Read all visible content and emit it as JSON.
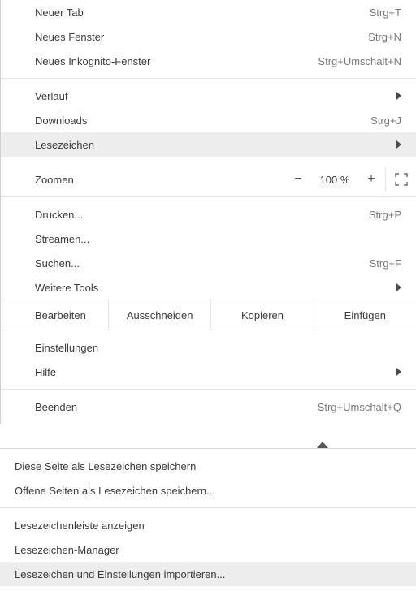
{
  "menu": {
    "new_tab": {
      "label": "Neuer Tab",
      "shortcut": "Strg+T"
    },
    "new_window": {
      "label": "Neues Fenster",
      "shortcut": "Strg+N"
    },
    "new_incognito": {
      "label": "Neues Inkognito-Fenster",
      "shortcut": "Strg+Umschalt+N"
    },
    "history": {
      "label": "Verlauf"
    },
    "downloads": {
      "label": "Downloads",
      "shortcut": "Strg+J"
    },
    "bookmarks": {
      "label": "Lesezeichen"
    },
    "zoom": {
      "label": "Zoomen",
      "value": "100 %"
    },
    "print": {
      "label": "Drucken...",
      "shortcut": "Strg+P"
    },
    "cast": {
      "label": "Streamen..."
    },
    "find": {
      "label": "Suchen...",
      "shortcut": "Strg+F"
    },
    "more_tools": {
      "label": "Weitere Tools"
    },
    "edit": {
      "label": "Bearbeiten",
      "cut": "Ausschneiden",
      "copy": "Kopieren",
      "paste": "Einfügen"
    },
    "settings": {
      "label": "Einstellungen"
    },
    "help": {
      "label": "Hilfe"
    },
    "exit": {
      "label": "Beenden",
      "shortcut": "Strg+Umschalt+Q"
    }
  },
  "bookmarks_submenu": {
    "bookmark_page": "Diese Seite als Lesezeichen speichern",
    "bookmark_open_pages": "Offene Seiten als Lesezeichen speichern...",
    "show_bar": "Lesezeichenleiste anzeigen",
    "manager": "Lesezeichen-Manager",
    "import": "Lesezeichen und Einstellungen importieren..."
  }
}
